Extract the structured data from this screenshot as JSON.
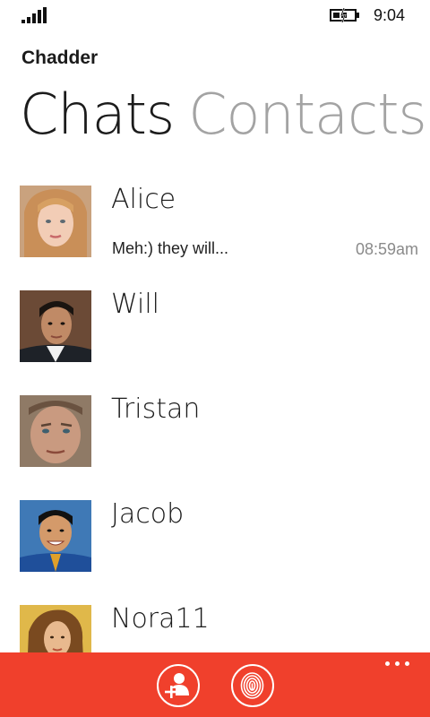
{
  "status_bar": {
    "time": "9:04",
    "signal_icon": "signal-bars-icon",
    "battery_icon": "battery-charging-icon"
  },
  "app": {
    "title": "Chadder"
  },
  "pivot": {
    "tabs": [
      {
        "label": "Chats",
        "active": true
      },
      {
        "label": "Contacts",
        "active": false
      }
    ]
  },
  "chats": [
    {
      "name": "Alice",
      "preview": "Meh:) they will...",
      "time": "08:59am"
    },
    {
      "name": "Will",
      "preview": "",
      "time": ""
    },
    {
      "name": "Tristan",
      "preview": "",
      "time": ""
    },
    {
      "name": "Jacob",
      "preview": "",
      "time": ""
    },
    {
      "name": "Nora11",
      "preview": "",
      "time": ""
    }
  ],
  "app_bar": {
    "background": "#f0402c",
    "buttons": [
      {
        "icon": "add-contact-icon"
      },
      {
        "icon": "fingerprint-icon"
      }
    ],
    "more_icon": "more-dots-icon"
  },
  "colors": {
    "accent": "#f0402c",
    "inactive_tab": "#a3a3a3",
    "timestamp": "#8a8a8a"
  }
}
